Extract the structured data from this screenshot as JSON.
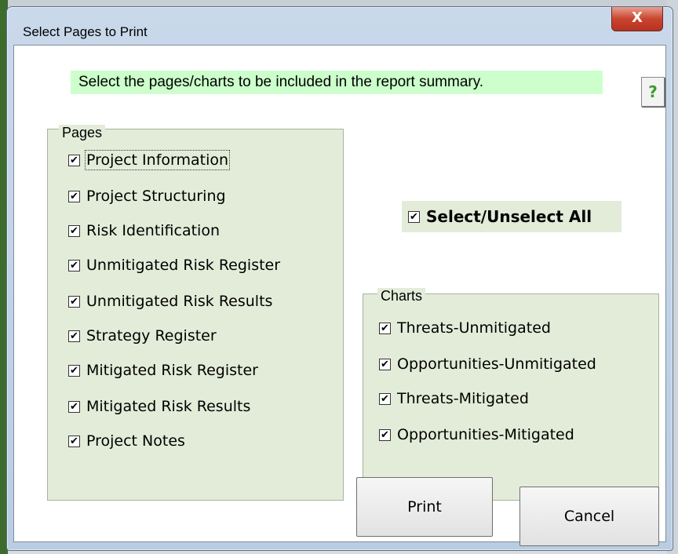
{
  "window": {
    "title": "Select Pages to Print",
    "close_label": "X"
  },
  "instruction": "Select the pages/charts to be included in the report summary.",
  "help_label": "?",
  "pages": {
    "legend": "Pages",
    "items": [
      {
        "label": "Project Information",
        "checked": true
      },
      {
        "label": "Project Structuring",
        "checked": true
      },
      {
        "label": "Risk Identification",
        "checked": true
      },
      {
        "label": "Unmitigated Risk Register",
        "checked": true
      },
      {
        "label": "Unmitigated Risk Results",
        "checked": true
      },
      {
        "label": "Strategy Register",
        "checked": true
      },
      {
        "label": "Mitigated Risk Register",
        "checked": true
      },
      {
        "label": "Mitigated Risk Results",
        "checked": true
      },
      {
        "label": "Project Notes",
        "checked": true
      }
    ]
  },
  "select_all": {
    "label": "Select/Unselect All",
    "checked": true
  },
  "charts": {
    "legend": "Charts",
    "items": [
      {
        "label": "Threats-Unmitigated",
        "checked": true
      },
      {
        "label": "Opportunities-Unmitigated",
        "checked": true
      },
      {
        "label": "Threats-Mitigated",
        "checked": true
      },
      {
        "label": "Opportunities-Mitigated",
        "checked": true
      }
    ]
  },
  "buttons": {
    "print_label": "Print",
    "cancel_label": "Cancel"
  },
  "check_glyph": "✔",
  "colors": {
    "instruction_bg": "#ccffcc",
    "frame_bg": "#e3ecd9",
    "help_fg": "#3d9a2f",
    "close_bg": "#c9452f"
  }
}
